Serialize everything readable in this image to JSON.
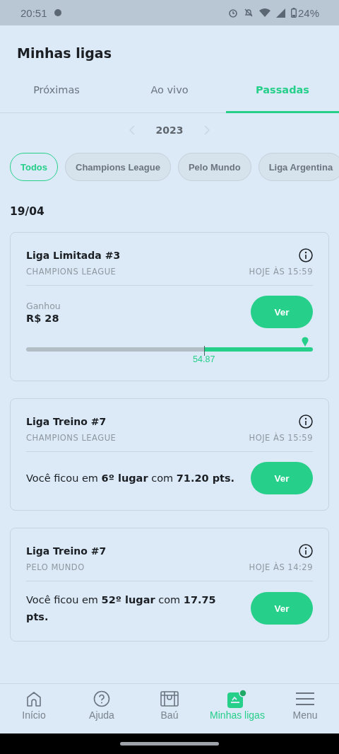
{
  "status_bar": {
    "time": "20:51",
    "battery": "24%"
  },
  "header": {
    "title": "Minhas ligas"
  },
  "tabs": [
    {
      "label": "Próximas",
      "selected": false
    },
    {
      "label": "Ao vivo",
      "selected": false
    },
    {
      "label": "Passadas",
      "selected": true
    }
  ],
  "year": "2023",
  "filters": [
    {
      "label": "Todos",
      "selected": true
    },
    {
      "label": "Champions League",
      "selected": false
    },
    {
      "label": "Pelo Mundo",
      "selected": false
    },
    {
      "label": "Liga Argentina",
      "selected": false
    }
  ],
  "date": "19/04",
  "cards": [
    {
      "kind": "prize",
      "title": "Liga Limitada #3",
      "league": "CHAMPIONS LEAGUE",
      "time": "HOJE ÀS 15:59",
      "result_label": "Ganhou",
      "amount": "R$ 28",
      "button": "Ver",
      "level": 0.62,
      "marker": "54.87"
    },
    {
      "kind": "rank",
      "title": "Liga Treino #7",
      "league": "CHAMPIONS LEAGUE",
      "time": "HOJE ÀS 15:59",
      "text": "Você ficou em **6º lugar** com **71.20 pts.**",
      "button": "Ver"
    },
    {
      "kind": "rank",
      "title": "Liga Treino #7",
      "league": "PELO MUNDO",
      "time": "HOJE ÀS 14:29",
      "text": "Você ficou em **52º lugar** com **17.75 pts.**",
      "button": "Ver"
    }
  ],
  "nav": [
    {
      "label": "Início",
      "selected": false
    },
    {
      "label": "Ajuda",
      "selected": false
    },
    {
      "label": "Baú",
      "selected": false
    },
    {
      "label": "Minhas ligas",
      "selected": true
    },
    {
      "label": "Menu",
      "selected": false
    }
  ]
}
